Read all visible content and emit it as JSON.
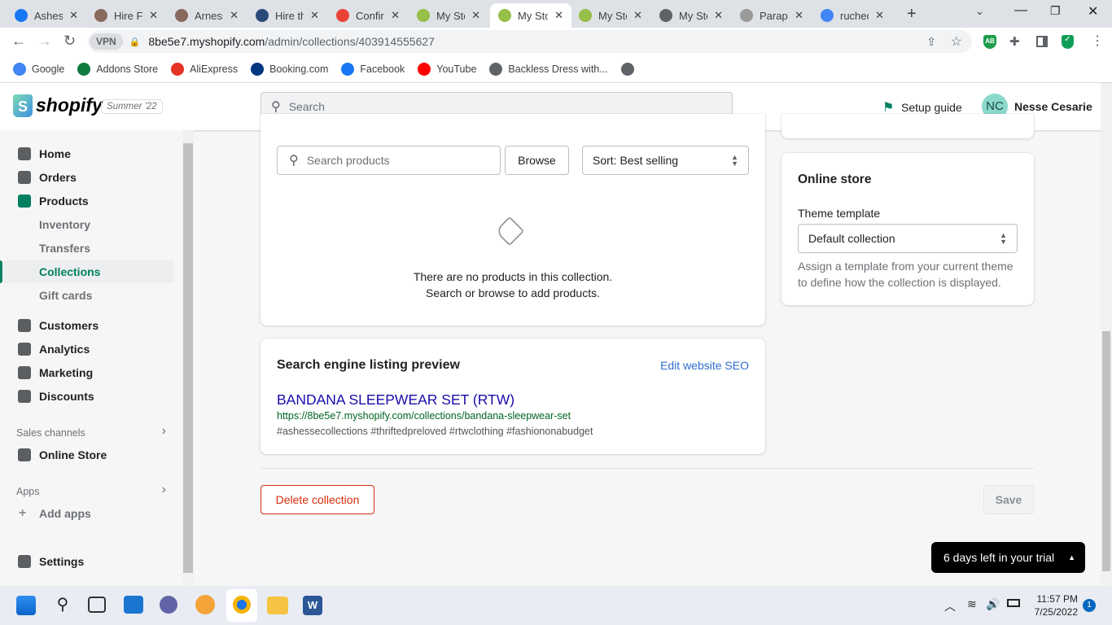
{
  "browser": {
    "tabs": [
      {
        "title": "Ashesse",
        "color": "#1877f2"
      },
      {
        "title": "Hire Fi",
        "color": "#8a6a5c"
      },
      {
        "title": "Arness",
        "color": "#8a6a5c"
      },
      {
        "title": "Hire th",
        "color": "#2b4a7a"
      },
      {
        "title": "Confirm",
        "color": "#ea4335"
      },
      {
        "title": "My Sto",
        "color": "#95bf47"
      },
      {
        "title": "My Sto",
        "color": "#95bf47",
        "active": true
      },
      {
        "title": "My Sto",
        "color": "#95bf47"
      },
      {
        "title": "My Sto",
        "color": "#5f6368"
      },
      {
        "title": "Paraph",
        "color": "#999"
      },
      {
        "title": "ruchec",
        "color": "#4285f4"
      }
    ],
    "vpn": "VPN",
    "url_host": "8be5e7.myshopify.com",
    "url_path": "/admin/collections/403914555627",
    "bookmarks": [
      {
        "label": "Google",
        "color": "#4285f4"
      },
      {
        "label": "Addons Store",
        "color": "#0f7b3f"
      },
      {
        "label": "AliExpress",
        "color": "#e43225"
      },
      {
        "label": "Booking.com",
        "color": "#003580"
      },
      {
        "label": "Facebook",
        "color": "#1877f2"
      },
      {
        "label": "YouTube",
        "color": "#ff0000"
      },
      {
        "label": "Backless Dress with...",
        "color": "#5f6368"
      }
    ],
    "ext_badge": "AB"
  },
  "topbar": {
    "logo": "shopify",
    "badge": "Summer '22",
    "search_placeholder": "Search",
    "setup_guide": "Setup guide",
    "avatar_initials": "NC",
    "user_name": "Nesse Cesarie"
  },
  "sidebar": {
    "items": [
      "Home",
      "Orders",
      "Products"
    ],
    "sub_items": [
      "Inventory",
      "Transfers",
      "Collections",
      "Gift cards"
    ],
    "items2": [
      "Customers",
      "Analytics",
      "Marketing",
      "Discounts"
    ],
    "sales_channels": "Sales channels",
    "online_store": "Online Store",
    "apps": "Apps",
    "add_apps": "Add apps",
    "settings": "Settings"
  },
  "products_card": {
    "search_placeholder": "Search products",
    "browse": "Browse",
    "sort": "Sort: Best selling",
    "empty_line1": "There are no products in this collection.",
    "empty_line2": "Search or browse to add products."
  },
  "seo_card": {
    "title": "Search engine listing preview",
    "edit_link": "Edit website SEO",
    "page_title": "BANDANA SLEEPWEAR SET (RTW)",
    "url": "https://8be5e7.myshopify.com/collections/bandana-sleepwear-set",
    "description": "#ashessecollections #thriftedpreloved #rtwclothing #fashiononabudget"
  },
  "online_store_card": {
    "title": "Online store",
    "label": "Theme template",
    "value": "Default collection",
    "help": "Assign a template from your current theme to define how the collection is displayed."
  },
  "footer": {
    "delete": "Delete collection",
    "save": "Save"
  },
  "trial": "6 days left in your trial",
  "taskbar": {
    "time": "11:57 PM",
    "date": "7/25/2022",
    "notifications": "1"
  }
}
